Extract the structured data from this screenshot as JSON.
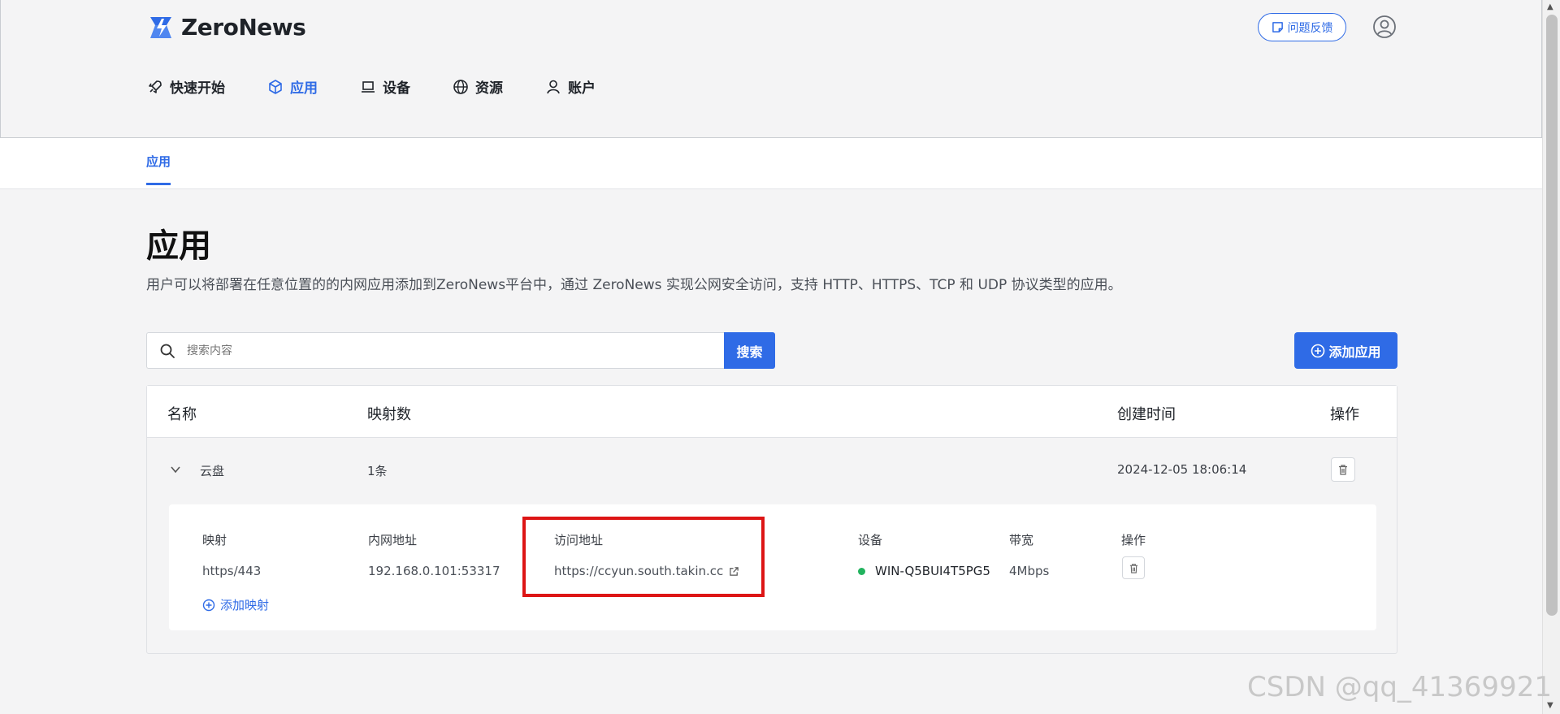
{
  "brand": {
    "name": "ZeroNews"
  },
  "header": {
    "feedback_label": "问题反馈"
  },
  "nav": [
    {
      "label": "快速开始",
      "icon": "rocket-icon"
    },
    {
      "label": "应用",
      "icon": "cube-icon"
    },
    {
      "label": "设备",
      "icon": "laptop-icon"
    },
    {
      "label": "资源",
      "icon": "globe-icon"
    },
    {
      "label": "账户",
      "icon": "user-icon"
    }
  ],
  "subnav": {
    "tab": "应用"
  },
  "page": {
    "title": "应用",
    "description": "用户可以将部署在任意位置的的内网应用添加到ZeroNews平台中，通过 ZeroNews 实现公网安全访问，支持 HTTP、HTTPS、TCP 和 UDP 协议类型的应用。"
  },
  "search": {
    "placeholder": "搜索内容",
    "button": "搜索"
  },
  "add_app_label": "添加应用",
  "table": {
    "headers": {
      "name": "名称",
      "mappings": "映射数",
      "created": "创建时间",
      "actions": "操作"
    },
    "rows": [
      {
        "name": "云盘",
        "mappings": "1条",
        "created": "2024-12-05 18:06:14",
        "detail": {
          "headers": {
            "mapping": "映射",
            "lan": "内网地址",
            "access": "访问地址",
            "device": "设备",
            "bandwidth": "带宽",
            "actions": "操作"
          },
          "values": {
            "mapping": "https/443",
            "lan": "192.168.0.101:53317",
            "access": "https://ccyun.south.takin.cc",
            "device": "WIN-Q5BUI4T5PG5",
            "bandwidth": "4Mbps"
          },
          "add_mapping_label": "添加映射"
        }
      }
    ]
  },
  "watermark": "CSDN @qq_41369921",
  "colors": {
    "accent": "#2f6be6",
    "online": "#22b35e",
    "highlight": "#dd1515"
  }
}
